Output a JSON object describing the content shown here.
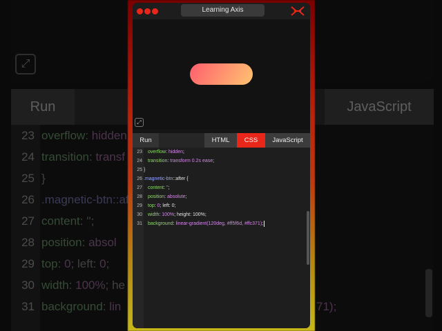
{
  "window": {
    "title": "Learning Axis",
    "logo_icon": "axis-logo-icon",
    "traffic_dot_color": "#e8261a"
  },
  "preview": {
    "button_gradient": [
      "#ff5f6d",
      "#ffc371"
    ],
    "expand_icon": "expand-arrows-icon"
  },
  "tabs": {
    "run": "Run",
    "html": "HTML",
    "css": "CSS",
    "javascript": "JavaScript",
    "active": "CSS",
    "active_color": "#e8261a"
  },
  "code": {
    "lines": [
      {
        "n": "23",
        "a": "overflow",
        "b": ": ",
        "c": "hidden",
        "d": ";"
      },
      {
        "n": "24",
        "a": "transition",
        "b": ": ",
        "c": "transform 0.2s ease",
        "d": ";"
      },
      {
        "n": "25",
        "a": "",
        "b": "",
        "c": "",
        "d": "}"
      },
      {
        "n": "26",
        "a": ".magnetic-btn",
        "b": "::",
        "c": "after",
        "d": " {"
      },
      {
        "n": "27",
        "a": "content",
        "b": ": ",
        "c": "''",
        "d": ";"
      },
      {
        "n": "28",
        "a": "position",
        "b": ": ",
        "c": "absolute",
        "d": ";"
      },
      {
        "n": "29",
        "a": "top",
        "b": ": ",
        "c": "0",
        "d": "; left: 0;"
      },
      {
        "n": "30",
        "a": "width",
        "b": ": ",
        "c": "100%",
        "d": "; height: 100%;"
      },
      {
        "n": "31",
        "a": "background",
        "b": ": ",
        "c": "linear-gradient(120deg, #ff5f6d, #ffc371)",
        "d": ";"
      }
    ]
  },
  "background": {
    "run": "Run",
    "javascript": "JavaScript"
  }
}
